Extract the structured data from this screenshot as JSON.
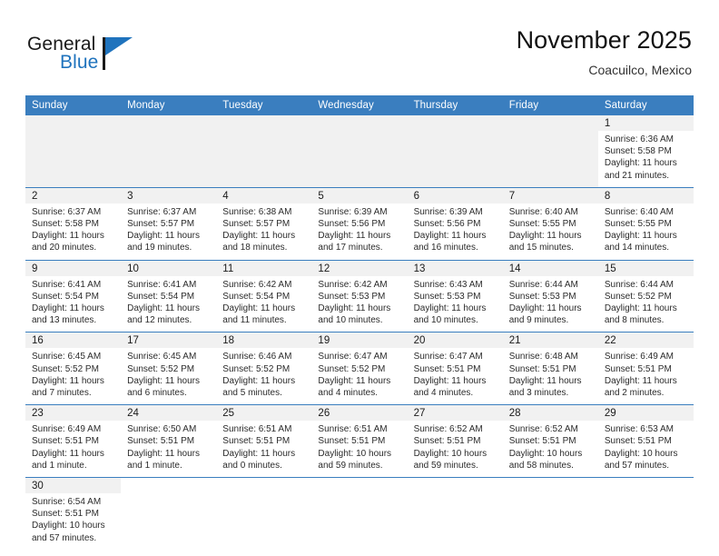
{
  "brand": {
    "name_primary": "General",
    "name_secondary": "Blue",
    "accent_color": "#1f73bd"
  },
  "header": {
    "title": "November 2025",
    "subtitle": "Coacuilco, Mexico"
  },
  "theme": {
    "header_blue": "#3a7ebf",
    "cell_band_gray": "#f1f1f1",
    "text_dark": "#2b2b2b"
  },
  "weekday_headers": [
    "Sunday",
    "Monday",
    "Tuesday",
    "Wednesday",
    "Thursday",
    "Friday",
    "Saturday"
  ],
  "labels": {
    "sunrise_prefix": "Sunrise:",
    "sunset_prefix": "Sunset:",
    "daylight_prefix": "Daylight:"
  },
  "weeks": [
    [
      {
        "empty": true
      },
      {
        "empty": true
      },
      {
        "empty": true
      },
      {
        "empty": true
      },
      {
        "empty": true
      },
      {
        "empty": true
      },
      {
        "day": "1",
        "sunrise": "Sunrise: 6:36 AM",
        "sunset": "Sunset: 5:58 PM",
        "daylight_1": "Daylight: 11 hours",
        "daylight_2": "and 21 minutes."
      }
    ],
    [
      {
        "day": "2",
        "sunrise": "Sunrise: 6:37 AM",
        "sunset": "Sunset: 5:58 PM",
        "daylight_1": "Daylight: 11 hours",
        "daylight_2": "and 20 minutes."
      },
      {
        "day": "3",
        "sunrise": "Sunrise: 6:37 AM",
        "sunset": "Sunset: 5:57 PM",
        "daylight_1": "Daylight: 11 hours",
        "daylight_2": "and 19 minutes."
      },
      {
        "day": "4",
        "sunrise": "Sunrise: 6:38 AM",
        "sunset": "Sunset: 5:57 PM",
        "daylight_1": "Daylight: 11 hours",
        "daylight_2": "and 18 minutes."
      },
      {
        "day": "5",
        "sunrise": "Sunrise: 6:39 AM",
        "sunset": "Sunset: 5:56 PM",
        "daylight_1": "Daylight: 11 hours",
        "daylight_2": "and 17 minutes."
      },
      {
        "day": "6",
        "sunrise": "Sunrise: 6:39 AM",
        "sunset": "Sunset: 5:56 PM",
        "daylight_1": "Daylight: 11 hours",
        "daylight_2": "and 16 minutes."
      },
      {
        "day": "7",
        "sunrise": "Sunrise: 6:40 AM",
        "sunset": "Sunset: 5:55 PM",
        "daylight_1": "Daylight: 11 hours",
        "daylight_2": "and 15 minutes."
      },
      {
        "day": "8",
        "sunrise": "Sunrise: 6:40 AM",
        "sunset": "Sunset: 5:55 PM",
        "daylight_1": "Daylight: 11 hours",
        "daylight_2": "and 14 minutes."
      }
    ],
    [
      {
        "day": "9",
        "sunrise": "Sunrise: 6:41 AM",
        "sunset": "Sunset: 5:54 PM",
        "daylight_1": "Daylight: 11 hours",
        "daylight_2": "and 13 minutes."
      },
      {
        "day": "10",
        "sunrise": "Sunrise: 6:41 AM",
        "sunset": "Sunset: 5:54 PM",
        "daylight_1": "Daylight: 11 hours",
        "daylight_2": "and 12 minutes."
      },
      {
        "day": "11",
        "sunrise": "Sunrise: 6:42 AM",
        "sunset": "Sunset: 5:54 PM",
        "daylight_1": "Daylight: 11 hours",
        "daylight_2": "and 11 minutes."
      },
      {
        "day": "12",
        "sunrise": "Sunrise: 6:42 AM",
        "sunset": "Sunset: 5:53 PM",
        "daylight_1": "Daylight: 11 hours",
        "daylight_2": "and 10 minutes."
      },
      {
        "day": "13",
        "sunrise": "Sunrise: 6:43 AM",
        "sunset": "Sunset: 5:53 PM",
        "daylight_1": "Daylight: 11 hours",
        "daylight_2": "and 10 minutes."
      },
      {
        "day": "14",
        "sunrise": "Sunrise: 6:44 AM",
        "sunset": "Sunset: 5:53 PM",
        "daylight_1": "Daylight: 11 hours",
        "daylight_2": "and 9 minutes."
      },
      {
        "day": "15",
        "sunrise": "Sunrise: 6:44 AM",
        "sunset": "Sunset: 5:52 PM",
        "daylight_1": "Daylight: 11 hours",
        "daylight_2": "and 8 minutes."
      }
    ],
    [
      {
        "day": "16",
        "sunrise": "Sunrise: 6:45 AM",
        "sunset": "Sunset: 5:52 PM",
        "daylight_1": "Daylight: 11 hours",
        "daylight_2": "and 7 minutes."
      },
      {
        "day": "17",
        "sunrise": "Sunrise: 6:45 AM",
        "sunset": "Sunset: 5:52 PM",
        "daylight_1": "Daylight: 11 hours",
        "daylight_2": "and 6 minutes."
      },
      {
        "day": "18",
        "sunrise": "Sunrise: 6:46 AM",
        "sunset": "Sunset: 5:52 PM",
        "daylight_1": "Daylight: 11 hours",
        "daylight_2": "and 5 minutes."
      },
      {
        "day": "19",
        "sunrise": "Sunrise: 6:47 AM",
        "sunset": "Sunset: 5:52 PM",
        "daylight_1": "Daylight: 11 hours",
        "daylight_2": "and 4 minutes."
      },
      {
        "day": "20",
        "sunrise": "Sunrise: 6:47 AM",
        "sunset": "Sunset: 5:51 PM",
        "daylight_1": "Daylight: 11 hours",
        "daylight_2": "and 4 minutes."
      },
      {
        "day": "21",
        "sunrise": "Sunrise: 6:48 AM",
        "sunset": "Sunset: 5:51 PM",
        "daylight_1": "Daylight: 11 hours",
        "daylight_2": "and 3 minutes."
      },
      {
        "day": "22",
        "sunrise": "Sunrise: 6:49 AM",
        "sunset": "Sunset: 5:51 PM",
        "daylight_1": "Daylight: 11 hours",
        "daylight_2": "and 2 minutes."
      }
    ],
    [
      {
        "day": "23",
        "sunrise": "Sunrise: 6:49 AM",
        "sunset": "Sunset: 5:51 PM",
        "daylight_1": "Daylight: 11 hours",
        "daylight_2": "and 1 minute."
      },
      {
        "day": "24",
        "sunrise": "Sunrise: 6:50 AM",
        "sunset": "Sunset: 5:51 PM",
        "daylight_1": "Daylight: 11 hours",
        "daylight_2": "and 1 minute."
      },
      {
        "day": "25",
        "sunrise": "Sunrise: 6:51 AM",
        "sunset": "Sunset: 5:51 PM",
        "daylight_1": "Daylight: 11 hours",
        "daylight_2": "and 0 minutes."
      },
      {
        "day": "26",
        "sunrise": "Sunrise: 6:51 AM",
        "sunset": "Sunset: 5:51 PM",
        "daylight_1": "Daylight: 10 hours",
        "daylight_2": "and 59 minutes."
      },
      {
        "day": "27",
        "sunrise": "Sunrise: 6:52 AM",
        "sunset": "Sunset: 5:51 PM",
        "daylight_1": "Daylight: 10 hours",
        "daylight_2": "and 59 minutes."
      },
      {
        "day": "28",
        "sunrise": "Sunrise: 6:52 AM",
        "sunset": "Sunset: 5:51 PM",
        "daylight_1": "Daylight: 10 hours",
        "daylight_2": "and 58 minutes."
      },
      {
        "day": "29",
        "sunrise": "Sunrise: 6:53 AM",
        "sunset": "Sunset: 5:51 PM",
        "daylight_1": "Daylight: 10 hours",
        "daylight_2": "and 57 minutes."
      }
    ],
    [
      {
        "day": "30",
        "sunrise": "Sunrise: 6:54 AM",
        "sunset": "Sunset: 5:51 PM",
        "daylight_1": "Daylight: 10 hours",
        "daylight_2": "and 57 minutes."
      },
      {
        "blank": true
      },
      {
        "blank": true
      },
      {
        "blank": true
      },
      {
        "blank": true
      },
      {
        "blank": true
      },
      {
        "blank": true
      }
    ]
  ]
}
